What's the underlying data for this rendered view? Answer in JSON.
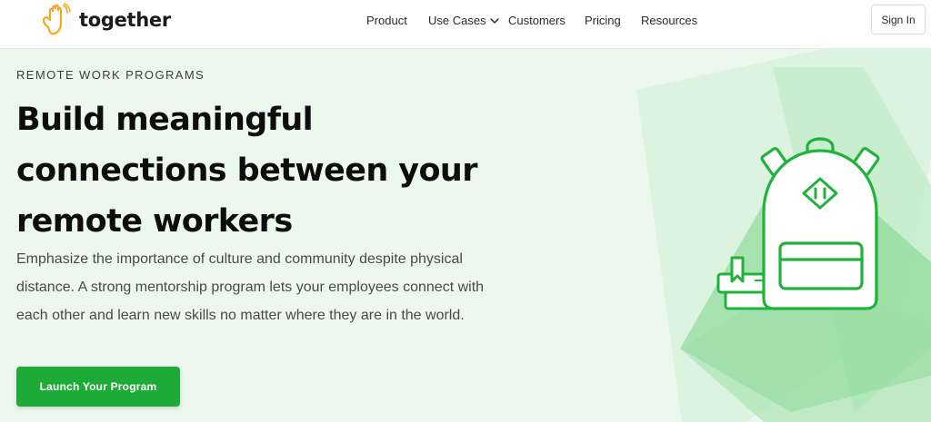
{
  "header": {
    "logo_text": "together",
    "nav": [
      {
        "label": "Product"
      },
      {
        "label": "Use Cases",
        "has_dropdown": true
      },
      {
        "label": "Customers"
      },
      {
        "label": "Pricing"
      },
      {
        "label": "Resources"
      }
    ],
    "signin_label": "Sign In"
  },
  "hero": {
    "eyebrow": "REMOTE WORK PROGRAMS",
    "headline_lines": [
      "Build meaningful",
      "connections between your",
      "remote workers"
    ],
    "subhead": "Emphasize the importance of culture and community despite physical distance. A strong mentorship program lets your employees connect with each other and learn new skills no matter where they are in the world.",
    "cta_label": "Launch Your Program"
  },
  "colors": {
    "brand_green": "#1eaa37",
    "logo_orange": "#f5a623",
    "hero_background": "#ecf8ee",
    "illustration_green": "#20b23a"
  },
  "icons": {
    "logo": "waving-hand-icon",
    "dropdown": "chevron-down-icon",
    "illustration": "backpack-icon"
  }
}
